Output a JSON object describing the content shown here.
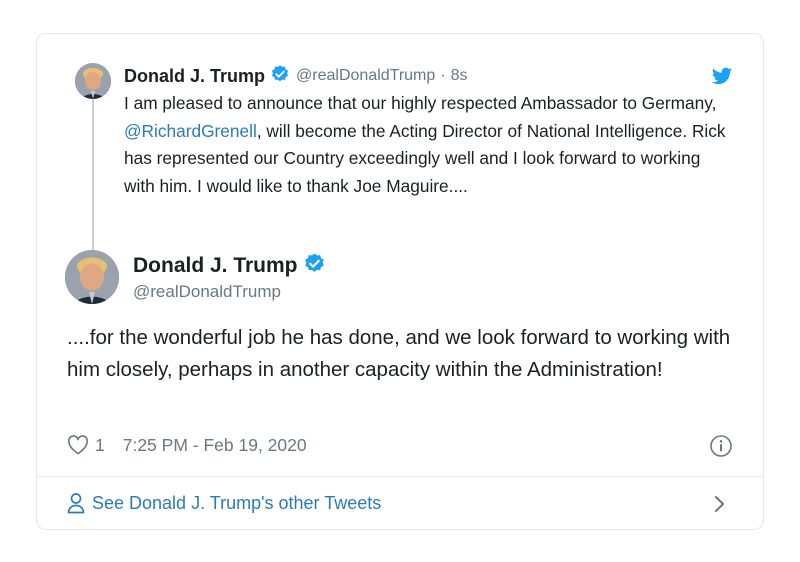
{
  "quoted_tweet": {
    "author_name": "Donald J. Trump",
    "handle": "@realDonaldTrump",
    "separator": "·",
    "time": "8s",
    "text_before_mention": "I am pleased to announce that our highly respected Ambassador to Germany, ",
    "mention": "@RichardGrenell",
    "text_after_mention": ", will become the Acting Director of National Intelligence. Rick has represented our Country exceedingly well and I look forward to working with him. I would like to thank Joe Maguire...."
  },
  "main_tweet": {
    "author_name": "Donald J. Trump",
    "handle": "@realDonaldTrump",
    "text": "....for the wonderful job he has done, and we look forward to working with him closely, perhaps in another capacity within the Administration!",
    "like_count": "1",
    "timestamp": "7:25 PM - Feb 19, 2020"
  },
  "footer": {
    "label": "See Donald J. Trump's other Tweets"
  },
  "icons": {
    "verified": "verified-badge-icon",
    "brand": "twitter-bird-icon",
    "like": "heart-icon",
    "info": "info-icon",
    "profile": "person-icon",
    "chevron": "chevron-right-icon"
  },
  "colors": {
    "link": "#2b7bb9",
    "verified": "#1da1f2",
    "muted": "#697882",
    "text": "#1c2022",
    "border": "#e1e8ed"
  }
}
